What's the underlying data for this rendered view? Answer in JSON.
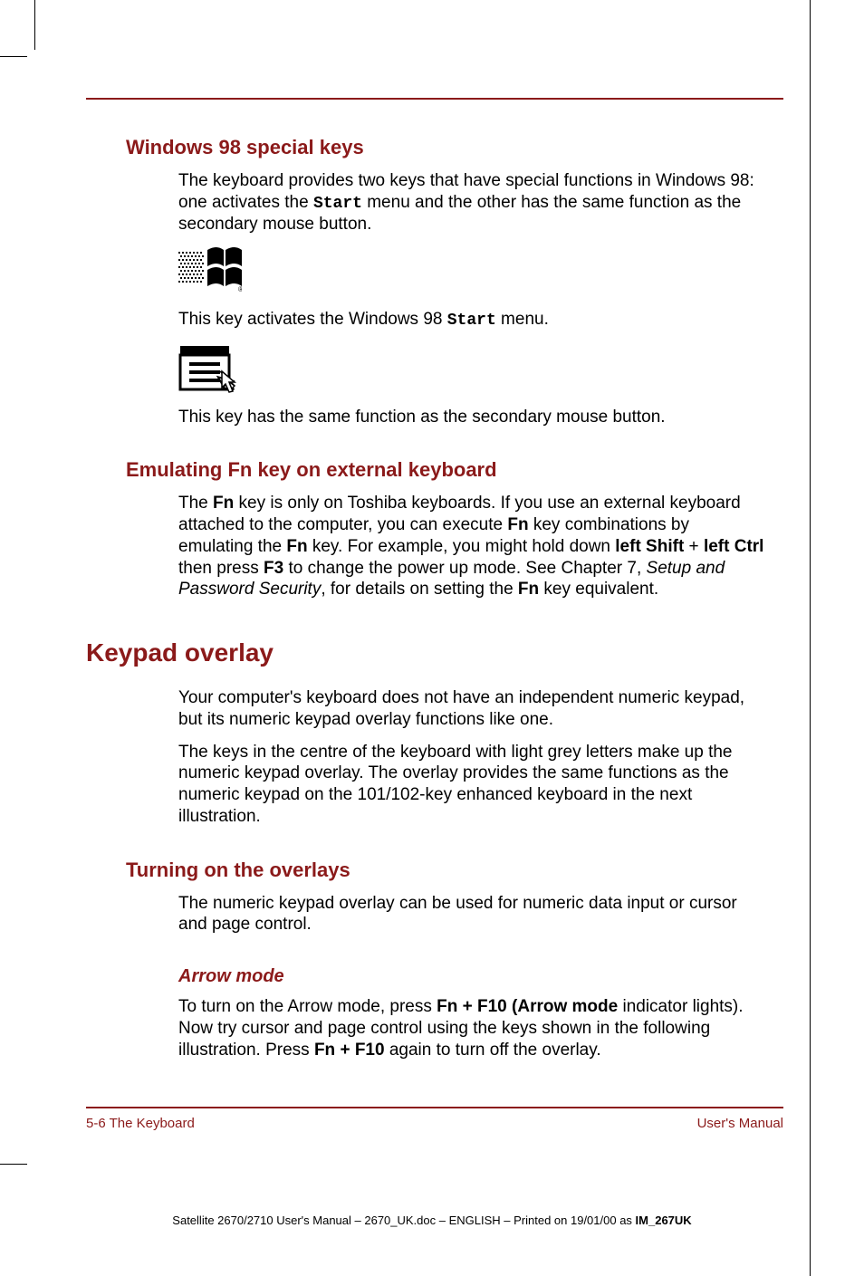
{
  "sections": {
    "win98": {
      "heading": "Windows 98 special keys",
      "p1_a": "The keyboard provides two keys that have special functions in Windows 98: one activates the ",
      "p1_mono": "Start",
      "p1_b": " menu and the other has the same function as the secondary mouse button.",
      "p2_a": "This key activates the Windows 98 ",
      "p2_mono": "Start",
      "p2_b": " menu.",
      "p3": "This key has the same function as the secondary mouse button."
    },
    "emulating": {
      "heading": "Emulating Fn key on external keyboard",
      "p_a": "The ",
      "p_fn1": "Fn",
      "p_b": " key is only on Toshiba keyboards. If you use an external keyboard attached to the computer, you can execute ",
      "p_fn2": "Fn",
      "p_c": " key combinations by emulating the ",
      "p_fn3": "Fn",
      "p_d": " key. For example, you might hold down ",
      "p_ls": "left Shift",
      "p_plus": " + ",
      "p_lc": "left Ctrl",
      "p_e": " then press ",
      "p_f3": "F3",
      "p_f": " to change the power up mode. See Chapter 7, ",
      "p_setup": "Setup and Password Security",
      "p_g": ", for details on setting the ",
      "p_fn4": "Fn",
      "p_h": " key equivalent."
    },
    "keypad": {
      "heading": "Keypad overlay",
      "p1": "Your computer's keyboard does not have an independent numeric keypad, but its numeric keypad overlay functions like one.",
      "p2": "The keys in the centre of the keyboard with light grey letters make up the numeric keypad overlay. The overlay provides the same functions as the numeric keypad on the 101/102-key enhanced keyboard in the next illustration."
    },
    "turning": {
      "heading": "Turning on the overlays",
      "p": "The numeric keypad overlay can be used for numeric data input or cursor and page control."
    },
    "arrow": {
      "heading": "Arrow mode",
      "p_a": "To turn on the Arrow mode, press ",
      "p_combo1": "Fn + F10 (Arrow mode",
      "p_b": " indicator lights). Now try cursor and page control using the keys shown in the following illustration. Press ",
      "p_combo2": "Fn + F10",
      "p_c": " again to turn off the overlay."
    }
  },
  "footer": {
    "left": "5-6  The Keyboard",
    "right": "User's Manual"
  },
  "imprint": {
    "a": "Satellite 2670/2710 User's Manual  – 2670_UK.doc – ENGLISH – Printed on 19/01/00 as ",
    "b": "IM_267UK"
  }
}
